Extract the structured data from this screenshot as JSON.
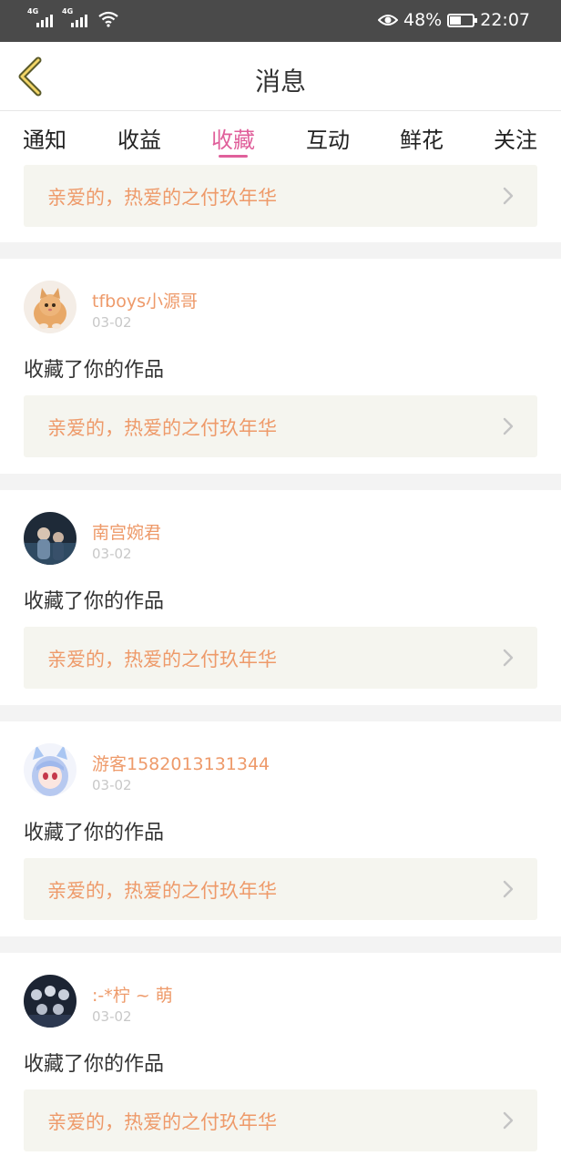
{
  "statusbar": {
    "network_left": "4G",
    "network_right": "4G",
    "battery": "48%",
    "battery_level": 0.48,
    "time": "22:07",
    "icons": [
      "signal-icon",
      "signal-icon",
      "wifi-icon",
      "eye-icon",
      "battery-icon"
    ]
  },
  "header": {
    "title": "消息",
    "back_icon": "chevron-left-icon"
  },
  "tabs": [
    {
      "label": "通知"
    },
    {
      "label": "收益"
    },
    {
      "label": "收藏"
    },
    {
      "label": "互动"
    },
    {
      "label": "鲜花"
    },
    {
      "label": "关注"
    }
  ],
  "active_tab": "收藏",
  "top_card": {
    "work_title": "亲爱的，热爱的之付玖年华"
  },
  "messages": [
    {
      "user": "tfboys小源哥",
      "date": "03-02",
      "action": "收藏了你的作品",
      "work_title": "亲爱的，热爱的之付玖年华"
    },
    {
      "user": "南宫婉君",
      "date": "03-02",
      "action": "收藏了你的作品",
      "work_title": "亲爱的，热爱的之付玖年华"
    },
    {
      "user": "游客1582013131344",
      "date": "03-02",
      "action": "收藏了你的作品",
      "work_title": "亲爱的，热爱的之付玖年华"
    },
    {
      "user": ":-*柠 ~ 萌",
      "date": "03-02",
      "action": "收藏了你的作品",
      "work_title": "亲爱的，热爱的之付玖年华"
    }
  ],
  "colors": {
    "accent": "#e0609b",
    "work_title": "#ee9a6a",
    "card_bg": "#f5f5ef",
    "statusbar_bg": "#4a4a4a"
  }
}
